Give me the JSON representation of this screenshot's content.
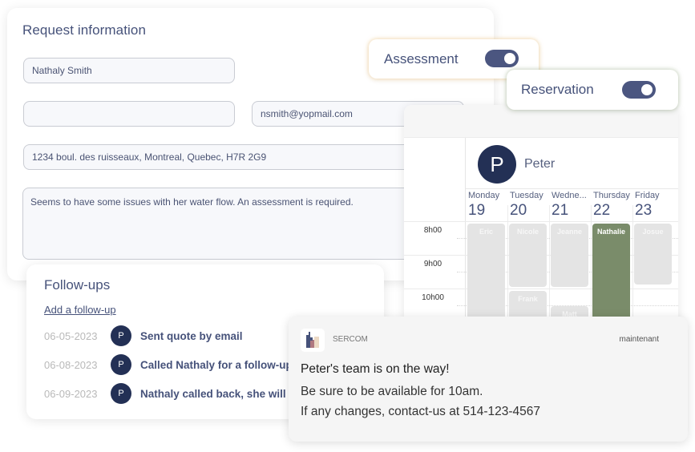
{
  "request_info": {
    "title": "Request information",
    "name_value": "Nathaly Smith",
    "phone_value": "",
    "email_value": "nsmith@yopmail.com",
    "address_value": "1234 boul. des ruisseaux, Montreal, Quebec, H7R 2G9",
    "notes_value": "Seems to have some issues with her water flow. An assessment is required."
  },
  "toggles": {
    "assessment": {
      "label": "Assessment",
      "on": true,
      "glow_color": "#f0be6e"
    },
    "reservation": {
      "label": "Reservation",
      "on": true,
      "glow_color": "#8ca578"
    },
    "track_color": "#4b5680"
  },
  "calendar": {
    "person_initial": "P",
    "person_name": "Peter",
    "days": [
      {
        "name": "Monday",
        "num": "19"
      },
      {
        "name": "Tuesday",
        "num": "20"
      },
      {
        "name": "Wedne...",
        "num": "21"
      },
      {
        "name": "Thursday",
        "num": "22"
      },
      {
        "name": "Friday",
        "num": "23"
      }
    ],
    "times": [
      "8h00",
      "9h00",
      "10h00"
    ],
    "events": [
      {
        "label": "Eric",
        "day": 0,
        "active": false
      },
      {
        "label": "Nicole",
        "day": 1,
        "active": false
      },
      {
        "label": "Frank",
        "day": 1,
        "active": false
      },
      {
        "label": "Jeanne",
        "day": 2,
        "active": false
      },
      {
        "label": "Matt",
        "day": 2,
        "active": false
      },
      {
        "label": "Nathalie",
        "day": 3,
        "active": true
      },
      {
        "label": "Josue",
        "day": 4,
        "active": false
      }
    ],
    "active_color": "#7a8c6a",
    "avatar_color": "#233055"
  },
  "followups": {
    "title": "Follow-ups",
    "add_label": "Add a follow-up",
    "items": [
      {
        "date": "06-05-2023",
        "initial": "P",
        "text": "Sent quote by email"
      },
      {
        "date": "06-08-2023",
        "initial": "P",
        "text": "Called Nathaly for a follow-up"
      },
      {
        "date": "06-09-2023",
        "initial": "P",
        "text": "Nathaly called back, she will c"
      }
    ]
  },
  "notification": {
    "app": "SERCOM",
    "time": "maintenant",
    "title": "Peter's team is on the way!",
    "line1": "Be sure to be available for 10am.",
    "line2": "If any changes, contact-us at 514-123-4567"
  }
}
